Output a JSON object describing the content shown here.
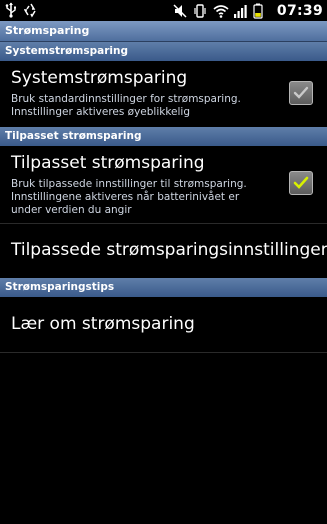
{
  "status_bar": {
    "time": "07:39",
    "left_icons": [
      "usb-icon",
      "recycle-icon"
    ],
    "right_icons": [
      "mute-icon",
      "vibrate-icon",
      "wifi-icon",
      "signal-icon",
      "battery-icon"
    ]
  },
  "title_bar": {
    "title": "Strømsparing"
  },
  "sections": [
    {
      "header": "Systemstrømsparing",
      "items": [
        {
          "title": "Systemstrømsparing",
          "summary": "Bruk standardinnstillinger for strømsparing. Innstillinger aktiveres øyeblikkelig",
          "checkbox": "checked-disabled"
        }
      ]
    },
    {
      "header": "Tilpasset strømsparing",
      "items": [
        {
          "title": "Tilpasset strømsparing",
          "summary": "Bruk tilpassede innstillinger til strømsparing. Innstillingene aktiveres når batterinivået er under verdien du angir",
          "checkbox": "checked"
        },
        {
          "title": "Tilpassede strømsparingsinnstillinger"
        }
      ]
    },
    {
      "header": "Strømsparingstips",
      "items": [
        {
          "title": "Lær om strømsparing"
        }
      ]
    }
  ],
  "colors": {
    "background": "#000000",
    "header_blue": "#4a6a98",
    "check_green": "#d8f000"
  }
}
